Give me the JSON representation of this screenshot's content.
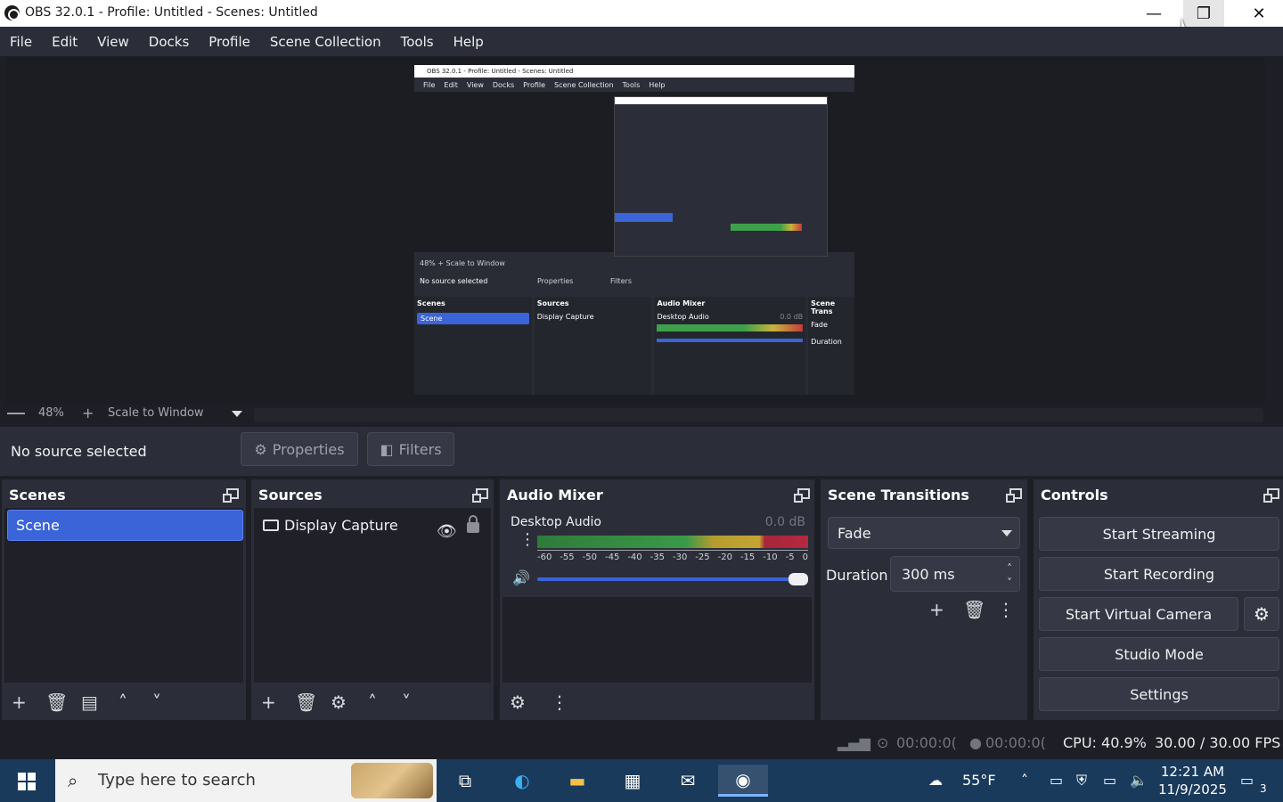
{
  "window": {
    "title": "OBS 32.0.1 - Profile: Untitled - Scenes: Untitled",
    "minimize": "—",
    "maximize": "❐",
    "close": "✕"
  },
  "menu": [
    "File",
    "Edit",
    "View",
    "Docks",
    "Profile",
    "Scene Collection",
    "Tools",
    "Help"
  ],
  "preview": {
    "mini_title": "OBS 32.0.1 - Profile: Untitled - Scenes: Untitled",
    "mini_menu": [
      "File",
      "Edit",
      "View",
      "Docks",
      "Profile",
      "Scene Collection",
      "Tools",
      "Help"
    ],
    "mini_zoom": "48%  +  Scale to Window",
    "mini_nosrc": "No source selected",
    "mini_properties": "Properties",
    "mini_filters": "Filters",
    "mini_scenes": "Scenes",
    "mini_scene": "Scene",
    "mini_sources": "Sources",
    "mini_display": "Display Capture",
    "mini_audio": "Audio Mixer",
    "mini_desktop": "Desktop Audio",
    "mini_db": "0.0 dB",
    "mini_trans": "Scene Trans",
    "mini_fade": "Fade",
    "mini_duration": "Duration"
  },
  "zoom": {
    "percent": "48%",
    "plus": "+",
    "mode": "Scale to Window"
  },
  "context": {
    "no_source": "No source selected",
    "properties": "Properties",
    "filters": "Filters",
    "properties_icon": "gear-icon",
    "filters_icon": "filter-icon"
  },
  "scenes": {
    "title": "Scenes",
    "items": [
      "Scene"
    ]
  },
  "sources": {
    "title": "Sources",
    "items": [
      "Display Capture"
    ]
  },
  "audio_mixer": {
    "title": "Audio Mixer",
    "channel": "Desktop Audio",
    "db": "0.0 dB",
    "ticks": [
      "-60",
      "-55",
      "-50",
      "-45",
      "-40",
      "-35",
      "-30",
      "-25",
      "-20",
      "-15",
      "-10",
      "-5",
      "0"
    ],
    "volume_level": 1.0
  },
  "transitions": {
    "title": "Scene Transitions",
    "selected": "Fade",
    "duration_label": "Duration",
    "duration_value": "300 ms"
  },
  "controls": {
    "title": "Controls",
    "start_streaming": "Start Streaming",
    "start_recording": "Start Recording",
    "start_virtual_camera": "Start Virtual Camera",
    "studio_mode": "Studio Mode",
    "settings": "Settings"
  },
  "status": {
    "stream_time": "00:00:0(",
    "rec_time": "00:00:0(",
    "cpu": "CPU: 40.9%",
    "fps": "30.00 / 30.00 FPS"
  },
  "taskbar": {
    "search_placeholder": "Type here to search",
    "weather": "55°F",
    "time": "12:21 AM",
    "date": "11/9/2025",
    "notifications": "3"
  },
  "colors": {
    "accent": "#3a64d8",
    "panel": "#2b2e38",
    "background": "#1e1f26"
  }
}
